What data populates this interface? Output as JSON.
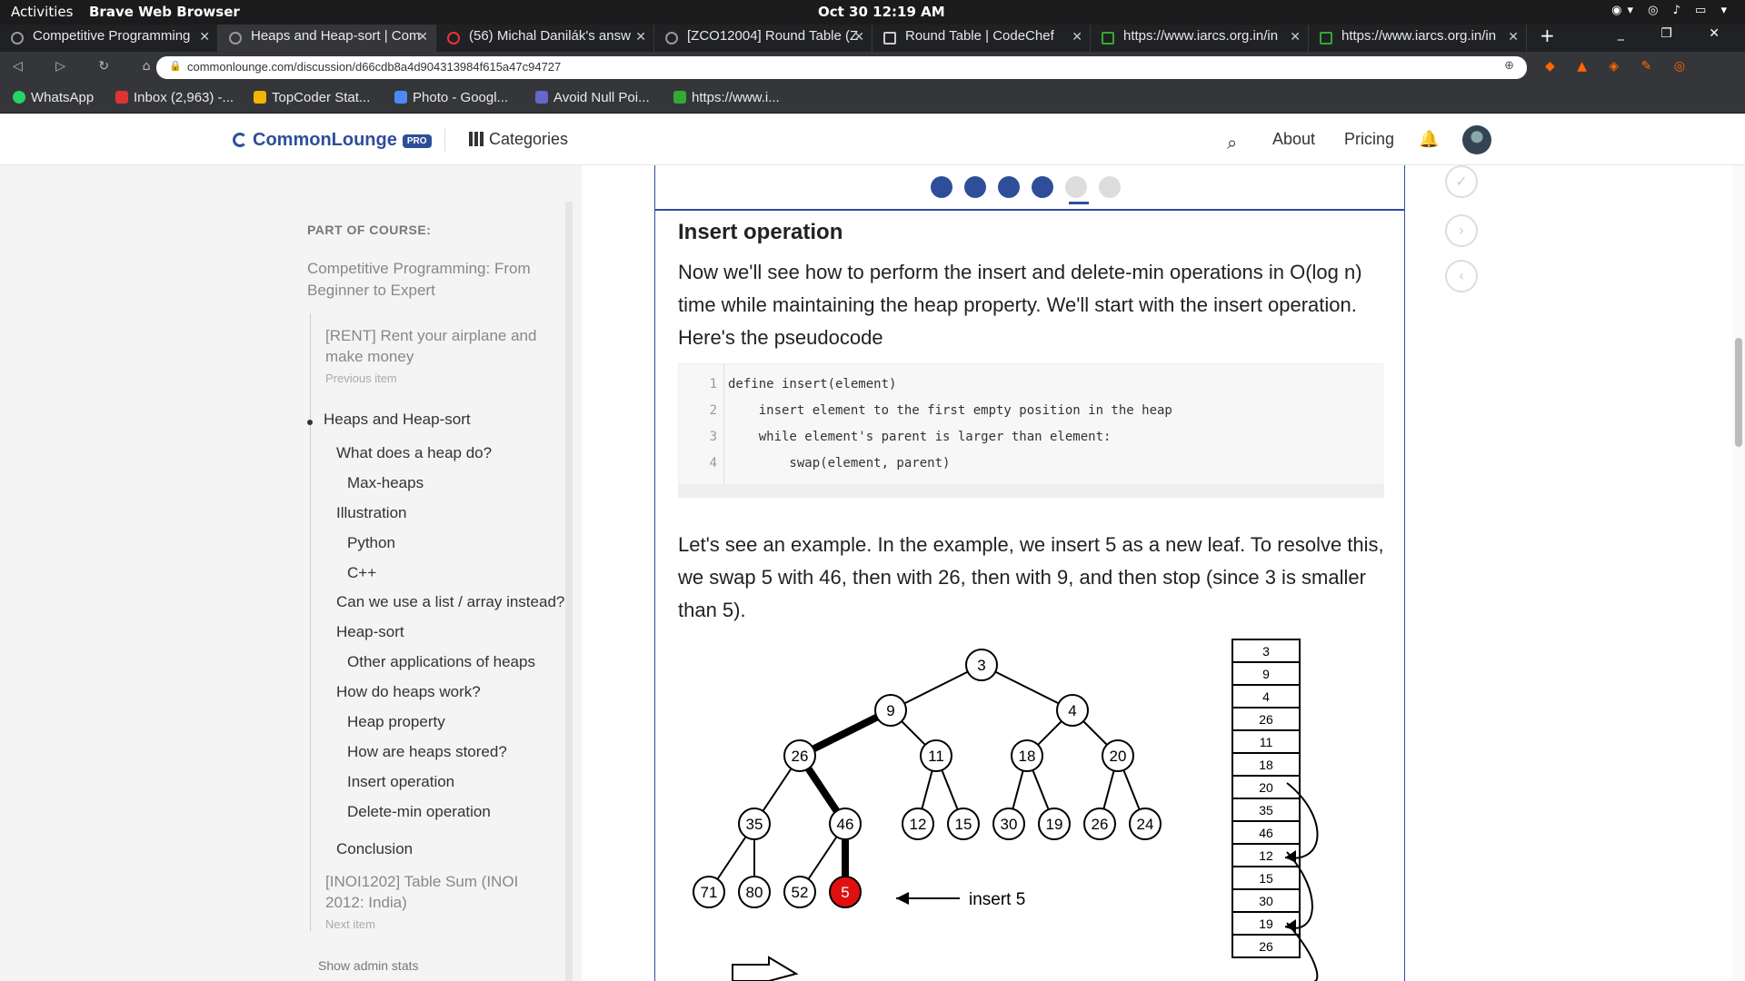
{
  "os": {
    "activities": "Activities",
    "app": "Brave Web Browser",
    "clock": "Oct 30  12:19 AM"
  },
  "tabs": [
    "Competitive Programming",
    "Heaps and Heap-sort | Com",
    "(56) Michal Danilák's answ",
    "[ZCO12004] Round Table (Z",
    "Round Table | CodeChef",
    "https://www.iarcs.org.in/in",
    "https://www.iarcs.org.in/in"
  ],
  "url": "commonlounge.com/discussion/d66cdb8a4d904313984f615a47c94727",
  "bookmarks": [
    "WhatsApp",
    "Inbox (2,963) -...",
    "TopCoder Stat...",
    "Photo - Googl...",
    "Avoid Null Poi...",
    "https://www.i..."
  ],
  "header": {
    "logo": "CommonLounge",
    "pro": "PRO",
    "categories": "Categories",
    "about": "About",
    "pricing": "Pricing"
  },
  "sidebar": {
    "label": "PART OF COURSE:",
    "course": "Competitive Programming: From Beginner to Expert",
    "prev_title": "[RENT] Rent your airplane and make money",
    "prev_sub": "Previous item",
    "current": "Heaps and Heap-sort",
    "items": [
      "What does a heap do?",
      "Max-heaps",
      "Illustration",
      "Python",
      "C++",
      "Can we use a list / array instead?",
      "Heap-sort",
      "Other applications of heaps",
      "How do heaps work?",
      "Heap property",
      "How are heaps stored?",
      "Insert operation",
      "Delete-min operation",
      "Conclusion"
    ],
    "next_title": "[INOI1202] Table Sum (INOI 2012: India)",
    "next_sub": "Next item",
    "admin": "Show admin stats"
  },
  "content": {
    "heading": "Insert operation",
    "para1": "Now we'll see how to perform the insert and delete-min operations in O(log n) time while maintaining the heap property. We'll start with the insert operation. Here's the pseudocode",
    "code": [
      {
        "n": "1",
        "t": "define insert(element)"
      },
      {
        "n": "2",
        "t": "    insert element to the first empty position in the heap"
      },
      {
        "n": "3",
        "t": "    while element's parent is larger than element:"
      },
      {
        "n": "4",
        "t": "        swap(element, parent)"
      }
    ],
    "para2": "Let's see an example. In the example, we insert 5 as a new leaf. To resolve this, we swap 5 with 46, then with 26, then with 9, and then stop (since 3 is smaller than 5).",
    "insert_label": "insert 5",
    "tree": [
      "3",
      "9",
      "4",
      "26",
      "11",
      "18",
      "20",
      "35",
      "46",
      "12",
      "15",
      "30",
      "19",
      "26",
      "24",
      "71",
      "80",
      "52",
      "5"
    ],
    "array": [
      "3",
      "9",
      "4",
      "26",
      "11",
      "18",
      "20",
      "35",
      "46",
      "12",
      "15",
      "30",
      "19",
      "26"
    ]
  },
  "progress": {
    "filled": 4,
    "total": 6
  },
  "colors": {
    "brand": "#2f4e9a",
    "highlight": "#e01010",
    "keyword": "#b5400f",
    "string": "#1a9e6b"
  }
}
